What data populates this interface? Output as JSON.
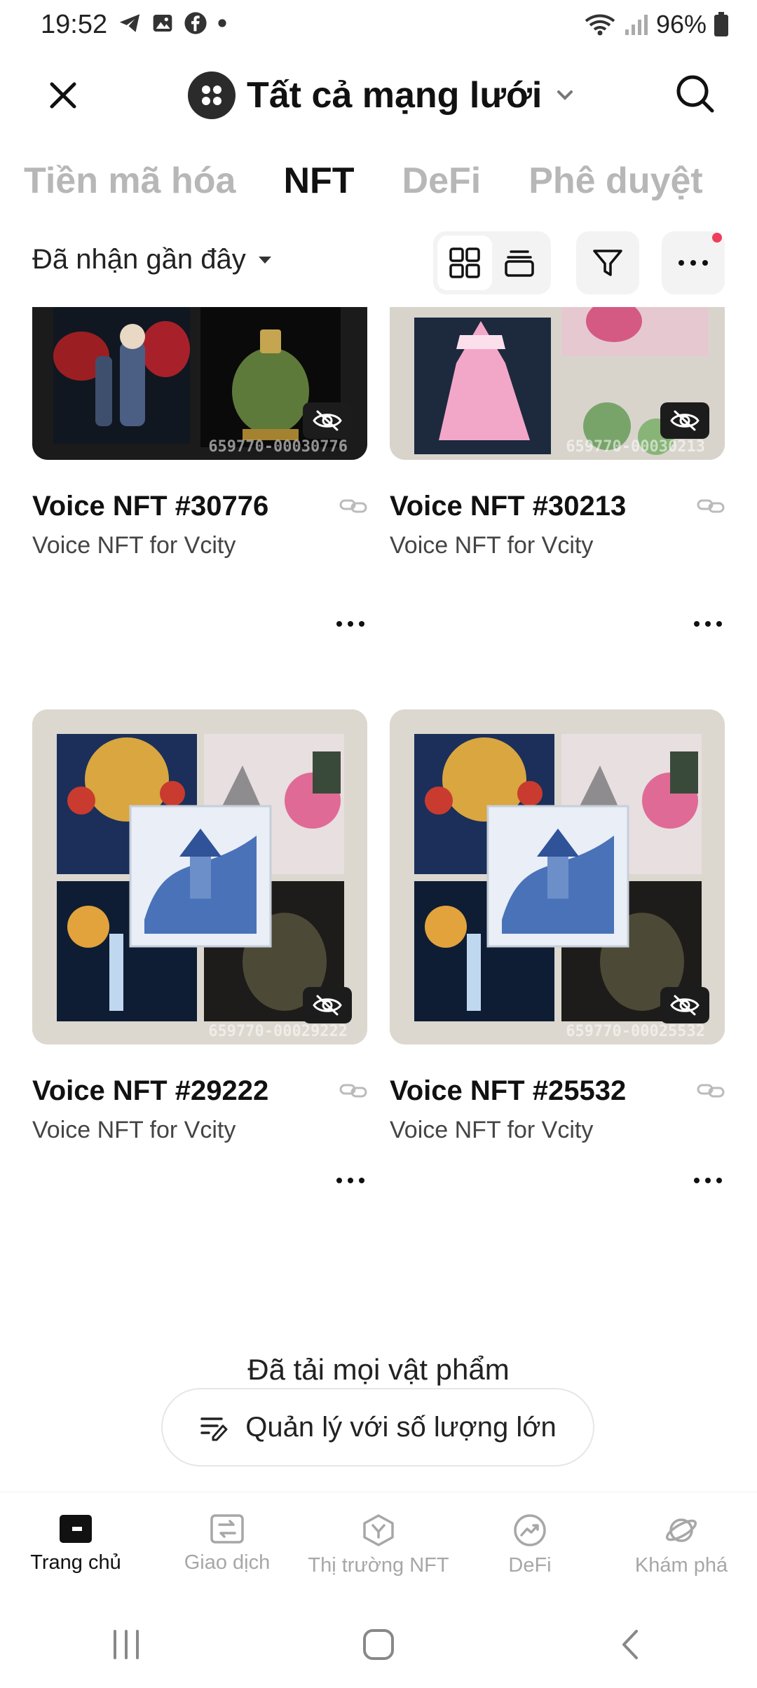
{
  "status_bar": {
    "time": "19:52",
    "battery": "96%"
  },
  "header": {
    "network_label": "Tất cả mạng lưới"
  },
  "tabs": [
    {
      "label": "Tiền mã hóa",
      "active": false
    },
    {
      "label": "NFT",
      "active": true
    },
    {
      "label": "DeFi",
      "active": false
    },
    {
      "label": "Phê duyệt",
      "active": false
    }
  ],
  "filter": {
    "sort_label": "Đã nhận gần đây"
  },
  "nfts": [
    {
      "title": "Voice NFT #30776",
      "subtitle": "Voice NFT for Vcity",
      "serial": "659770-00030776"
    },
    {
      "title": "Voice NFT #30213",
      "subtitle": "Voice NFT for Vcity",
      "serial": "659770-00030213"
    },
    {
      "title": "Voice NFT #29222",
      "subtitle": "Voice NFT for Vcity",
      "serial": "659770-00029222"
    },
    {
      "title": "Voice NFT #25532",
      "subtitle": "Voice NFT for Vcity",
      "serial": "659770-00025532"
    }
  ],
  "footer": {
    "all_loaded": "Đã tải mọi vật phẩm",
    "bulk_manage": "Quản lý với số lượng lớn"
  },
  "bottom_nav": [
    {
      "label": "Trang chủ",
      "icon": "wallet-icon",
      "active": true
    },
    {
      "label": "Giao dịch",
      "icon": "swap-icon",
      "active": false
    },
    {
      "label": "Thị trường NFT",
      "icon": "nft-market-icon",
      "active": false
    },
    {
      "label": "DeFi",
      "icon": "defi-icon",
      "active": false
    },
    {
      "label": "Khám phá",
      "icon": "explore-planet-icon",
      "active": false
    }
  ],
  "colors": {
    "accent_dot": "#ee3e5a",
    "inactive": "#a7a7a7"
  }
}
